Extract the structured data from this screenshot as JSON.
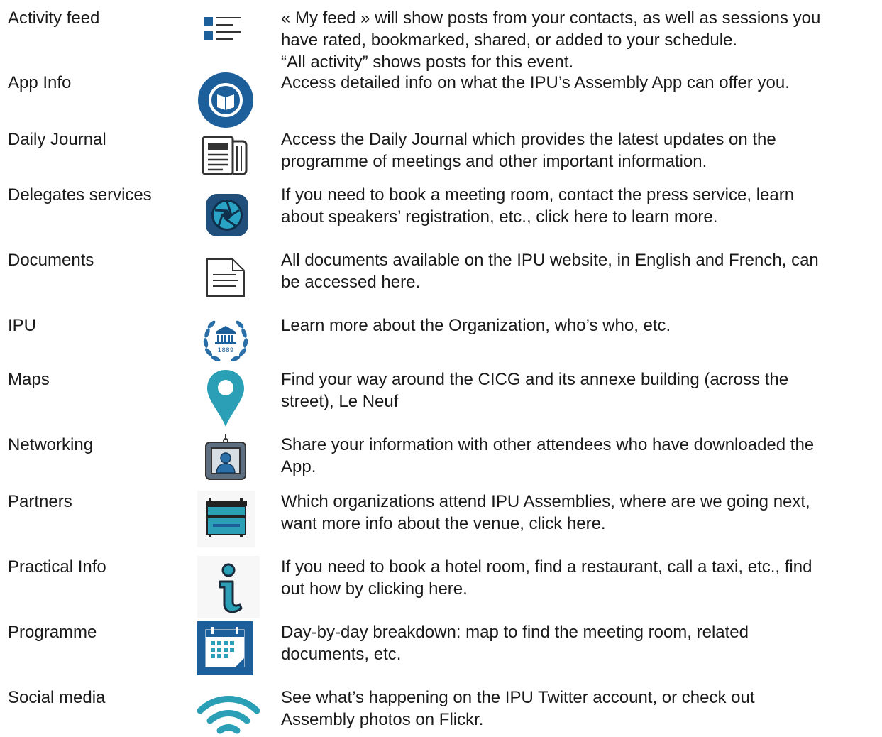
{
  "rows": [
    {
      "label": "Activity feed",
      "icon": "list-icon",
      "description": [
        "« My feed » will show posts from your contacts, as well as sessions you",
        "have rated, bookmarked, shared, or added to your schedule.",
        "“All activity” shows posts for this event."
      ]
    },
    {
      "label": "App Info",
      "icon": "book-circle-icon",
      "description": [
        "Access detailed info on what the IPU’s Assembly App can offer you."
      ]
    },
    {
      "label": "Daily Journal",
      "icon": "newspaper-icon",
      "description": [
        "Access the Daily Journal which provides the latest updates on the",
        "programme of meetings and other important information."
      ]
    },
    {
      "label": "Delegates services",
      "icon": "aperture-icon",
      "description": [
        "If you need to book a meeting room, contact the press service, learn",
        "about speakers’ registration, etc., click here to learn more."
      ]
    },
    {
      "label": "Documents",
      "icon": "document-icon",
      "description": [
        "All documents available on the IPU website, in English and French, can",
        "be accessed here."
      ]
    },
    {
      "label": "IPU",
      "icon": "ipu-logo-icon",
      "logo_text": "1889",
      "description": [
        "Learn more about the Organization, who’s who, etc."
      ]
    },
    {
      "label": "Maps",
      "icon": "map-pin-icon",
      "description": [
        "Find your way around the CICG and its annexe building (across the",
        "street), Le Neuf"
      ]
    },
    {
      "label": "Networking",
      "icon": "badge-icon",
      "description": [
        "Share your information with other attendees who have downloaded the",
        "App."
      ]
    },
    {
      "label": "Partners",
      "icon": "signboard-icon",
      "description": [
        "Which organizations attend IPU Assemblies, where are we going next,",
        "want more info about the venue, click here."
      ]
    },
    {
      "label": "Practical Info",
      "icon": "info-icon",
      "description": [
        "If you need to book a hotel room, find a restaurant, call a taxi, etc., find",
        "out how by clicking here."
      ]
    },
    {
      "label": "Programme",
      "icon": "calendar-icon",
      "description": [
        "Day-by-day breakdown: map to find the meeting room, related",
        "documents, etc."
      ]
    },
    {
      "label": "Social media",
      "icon": "wifi-icon",
      "description": [
        "See what’s happening on the IPU Twitter account, or check out",
        "Assembly photos on Flickr."
      ]
    }
  ],
  "colors": {
    "navy": "#1d5f9a",
    "teal": "#2a9fb5",
    "text": "#1a1a1a"
  }
}
